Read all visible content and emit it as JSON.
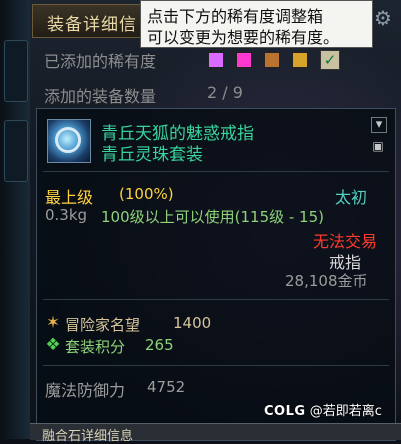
{
  "header": {
    "title": "装备详细信"
  },
  "tooltip": {
    "line1": "点击下方的稀有度调整箱",
    "line2": "可以变更为想要的稀有度。"
  },
  "rarity": {
    "label": "已添加的稀有度",
    "colors": [
      "#d96bff",
      "#ff39d0",
      "#b9722f",
      "#d8a32c",
      "#c9c0a0"
    ]
  },
  "equip_count": {
    "label": "添加的装备数量",
    "value": "2 / 9"
  },
  "item": {
    "name": "青丘天狐的魅惑戒指",
    "set": "青丘灵珠套装",
    "grade": "最上级",
    "grade_pct": "(100%)",
    "rarity_name": "太初",
    "weight": "0.3kg",
    "level_req": "100级以上可以使用(115级 - 15)",
    "trade": "无法交易",
    "type": "戒指",
    "price": "28,108金币",
    "stats": [
      {
        "icon": "adventurer-fame-icon",
        "label": "冒险家名望",
        "value": "1400"
      },
      {
        "icon": "set-points-icon",
        "label": "套装积分",
        "value": "265"
      }
    ],
    "magic_def": {
      "label": "魔法防御力",
      "value": "4752"
    }
  },
  "bottom": {
    "label": "融合石详细信息"
  },
  "watermark": {
    "brand": "COLG",
    "user": "@若即若离c"
  }
}
